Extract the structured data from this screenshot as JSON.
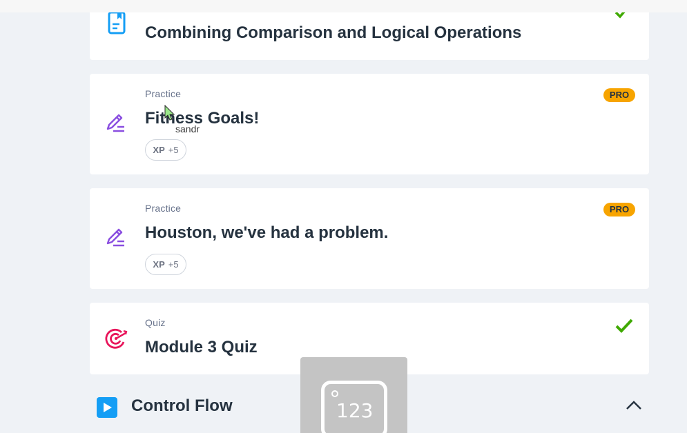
{
  "lessons": [
    {
      "type": "",
      "title": "Combining Comparison and Logical Operations",
      "icon": "lesson-doc-icon",
      "completed": true
    },
    {
      "type": "Practice",
      "title": "Fitness Goals!",
      "icon": "pencil-practice-icon",
      "xp_label": "XP",
      "xp_value": "+5",
      "badge": "PRO"
    },
    {
      "type": "Practice",
      "title": "Houston, we've had a problem.",
      "icon": "pencil-practice-icon",
      "xp_label": "XP",
      "xp_value": "+5",
      "badge": "PRO"
    },
    {
      "type": "Quiz",
      "title": "Module 3 Quiz",
      "icon": "target-quiz-icon",
      "completed": true
    }
  ],
  "section": {
    "title": "Control Flow",
    "expanded": true
  },
  "cursor": {
    "label": "sandr"
  },
  "overlay": {
    "keypad_text": "123"
  },
  "colors": {
    "accent_blue": "#149ef5",
    "pro_badge": "#f7a400",
    "check_green": "#3fa900",
    "practice_icon": "#8a4ee0",
    "quiz_icon": "#e8155b"
  }
}
